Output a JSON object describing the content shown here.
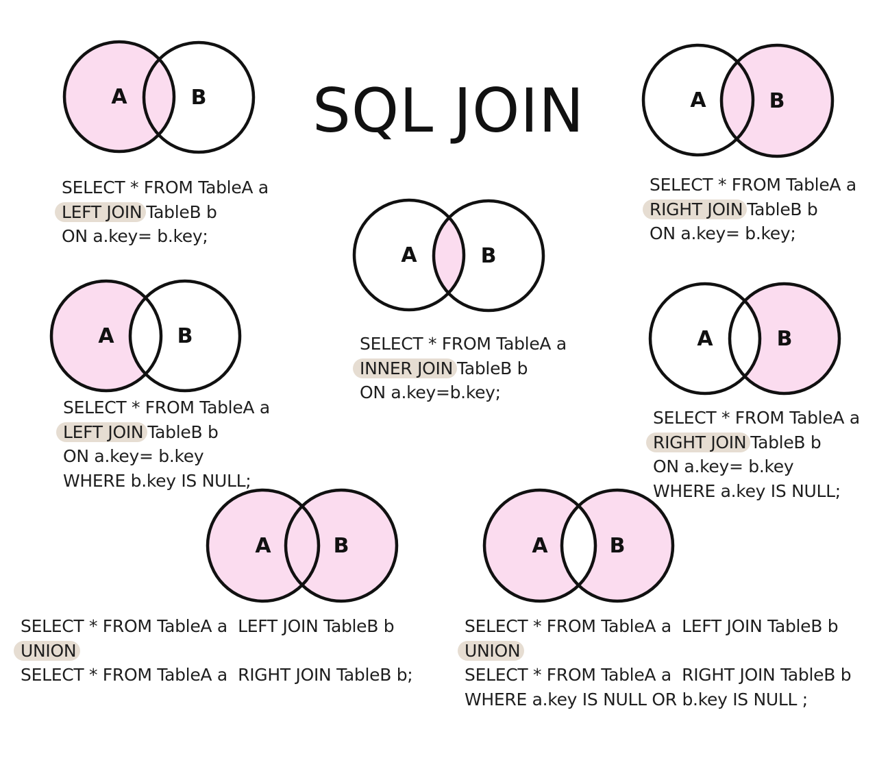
{
  "title": "SQL JOIN",
  "colors": {
    "fill": "#fbdcef",
    "stroke": "#111111",
    "highlight": "#e6ddd2"
  },
  "circle_labels": {
    "a": "A",
    "b": "B"
  },
  "panels": [
    {
      "id": "left-join",
      "shade": "a",
      "code": [
        {
          "text": "SELECT * FROM TableA a"
        },
        {
          "hl": "LEFT JOIN",
          "text": "TableB b"
        },
        {
          "text": "ON a.key= b.key;"
        }
      ]
    },
    {
      "id": "right-join",
      "shade": "b",
      "code": [
        {
          "text": "SELECT * FROM TableA a"
        },
        {
          "hl": "RIGHT JOIN",
          "text": "TableB b"
        },
        {
          "text": "ON a.key= b.key;"
        }
      ]
    },
    {
      "id": "inner-join",
      "shade": "intersection",
      "code": [
        {
          "text": "SELECT * FROM TableA a"
        },
        {
          "hl": "INNER JOIN",
          "text": "TableB b"
        },
        {
          "text": "ON a.key=b.key;"
        }
      ]
    },
    {
      "id": "left-excluding-join",
      "shade": "a-only",
      "code": [
        {
          "text": "SELECT * FROM TableA a"
        },
        {
          "hl": "LEFT JOIN",
          "text": "TableB b"
        },
        {
          "text": "ON a.key= b.key"
        },
        {
          "text": "WHERE b.key IS NULL;"
        }
      ]
    },
    {
      "id": "right-excluding-join",
      "shade": "b-only",
      "code": [
        {
          "text": "SELECT * FROM TableA a"
        },
        {
          "hl": "RIGHT JOIN",
          "text": "TableB b"
        },
        {
          "text": "ON a.key= b.key"
        },
        {
          "text": "WHERE a.key IS NULL;"
        }
      ]
    },
    {
      "id": "full-outer-join",
      "shade": "both",
      "code": [
        {
          "text": "SELECT * FROM TableA a  LEFT JOIN TableB b"
        },
        {
          "hl": "UNION",
          "text": ""
        },
        {
          "text": "SELECT * FROM TableA a  RIGHT JOIN TableB b;"
        }
      ]
    },
    {
      "id": "full-outer-excluding-join",
      "shade": "both-excluding",
      "code": [
        {
          "text": "SELECT * FROM TableA a  LEFT JOIN TableB b"
        },
        {
          "hl": "UNION",
          "text": ""
        },
        {
          "text": "SELECT * FROM TableA a  RIGHT JOIN TableB b"
        },
        {
          "text": "WHERE a.key IS NULL OR b.key IS NULL ;"
        }
      ]
    }
  ]
}
